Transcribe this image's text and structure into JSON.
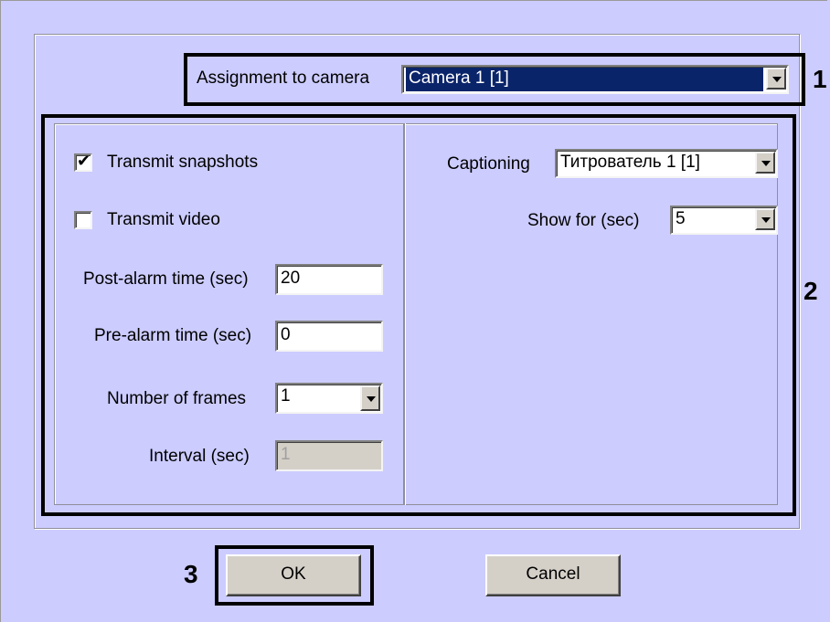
{
  "assignment": {
    "label": "Assignment to camera",
    "value": "Camera 1 [1]"
  },
  "left_panel": {
    "transmit_snapshots": {
      "label": "Transmit snapshots",
      "checked": true
    },
    "transmit_video": {
      "label": "Transmit video",
      "checked": false
    },
    "post_alarm": {
      "label": "Post-alarm time (sec)",
      "value": "20"
    },
    "pre_alarm": {
      "label": "Pre-alarm time (sec)",
      "value": "0"
    },
    "frames": {
      "label": "Number of frames",
      "value": "1"
    },
    "interval": {
      "label": "Interval (sec)",
      "value": "1"
    }
  },
  "right_panel": {
    "captioning": {
      "label": "Captioning",
      "value": "Титрователь 1 [1]"
    },
    "show_for": {
      "label": "Show for (sec)",
      "value": "5"
    }
  },
  "buttons": {
    "ok": "OK",
    "cancel": "Cancel"
  },
  "markers": {
    "m1": "1",
    "m2": "2",
    "m3": "3"
  }
}
